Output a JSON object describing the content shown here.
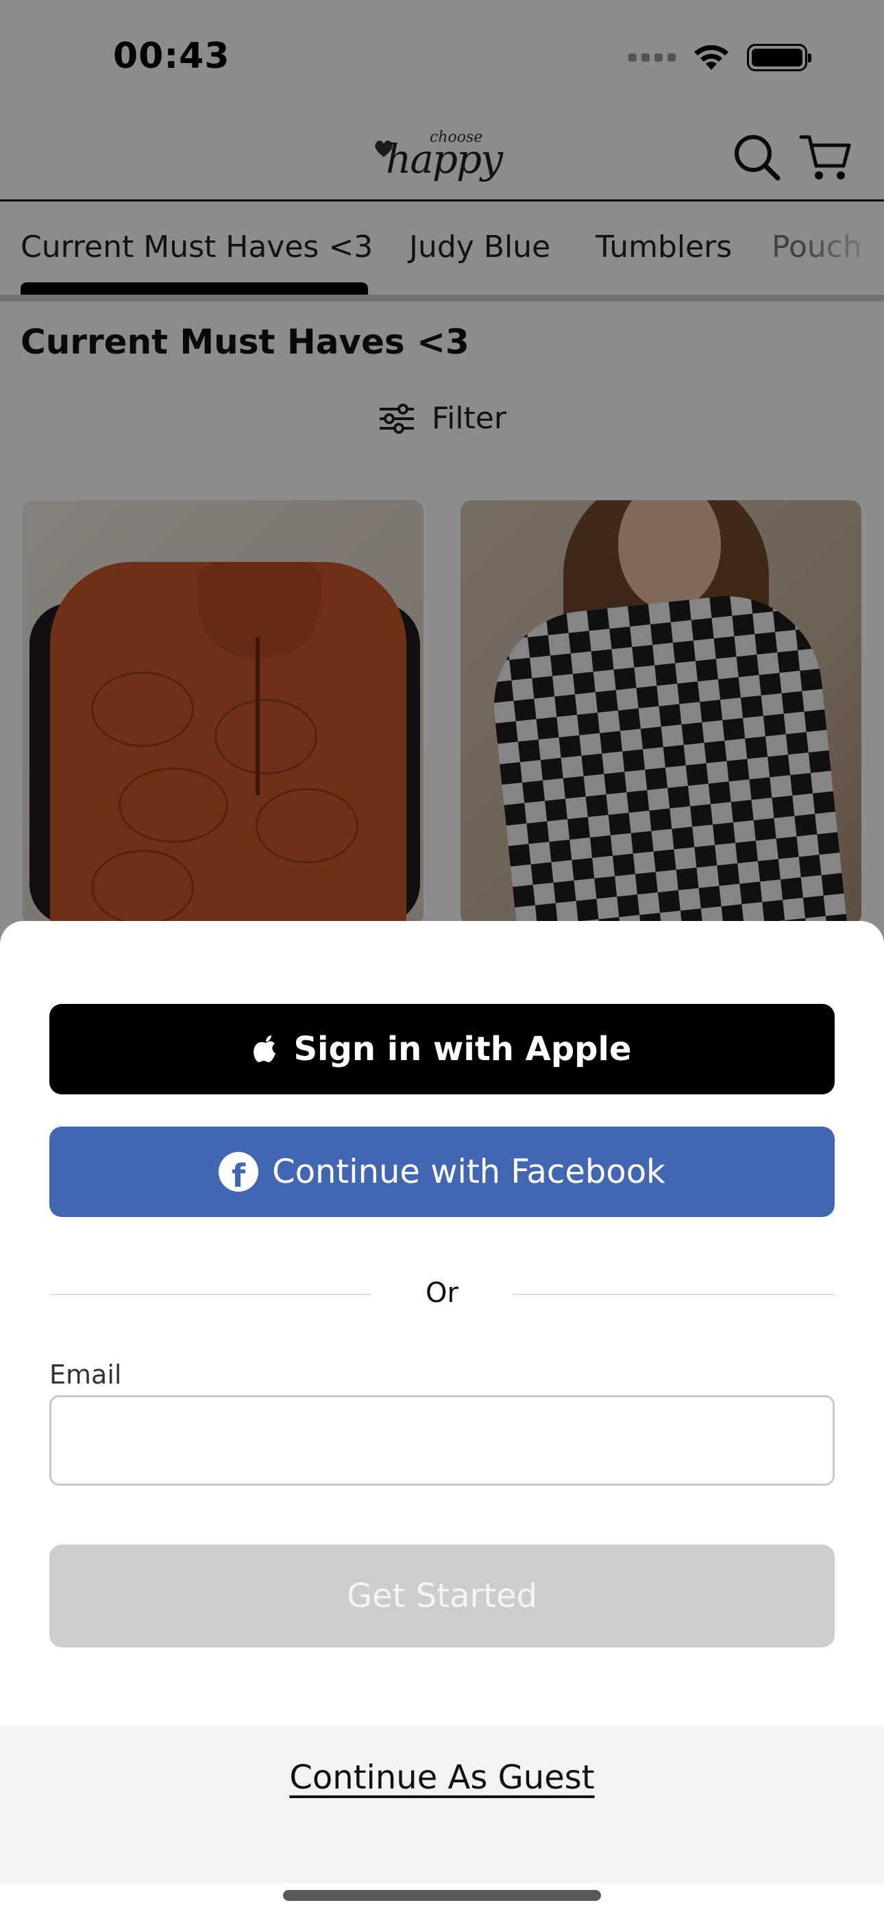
{
  "status_bar": {
    "time": "00:43"
  },
  "header": {
    "logo_small_text": "choose",
    "logo_main_text": "happy",
    "icons": [
      "search-icon",
      "cart-icon"
    ]
  },
  "tabs": [
    {
      "label": "Current Must Haves <3",
      "active": true
    },
    {
      "label": "Judy Blue",
      "active": false
    },
    {
      "label": "Tumblers",
      "active": false
    },
    {
      "label": "Pouch",
      "active": false
    }
  ],
  "section": {
    "title": "Current Must Haves <3",
    "filter_label": "Filter"
  },
  "products": [
    {
      "image": "orange quilted vest over black long sleeve"
    },
    {
      "image": "black and white checkered mesh top"
    }
  ],
  "sheet": {
    "apple_label": "Sign in with Apple",
    "facebook_label": "Continue with Facebook",
    "or_label": "Or",
    "email_label": "Email",
    "email_value": "",
    "email_placeholder": "",
    "get_started_label": "Get Started",
    "guest_label": "Continue As Guest"
  },
  "colors": {
    "apple_button": "#000000",
    "facebook_button": "#4267B2",
    "get_started_disabled": "#CDCDCD",
    "guest_band": "#F3F3F3"
  }
}
